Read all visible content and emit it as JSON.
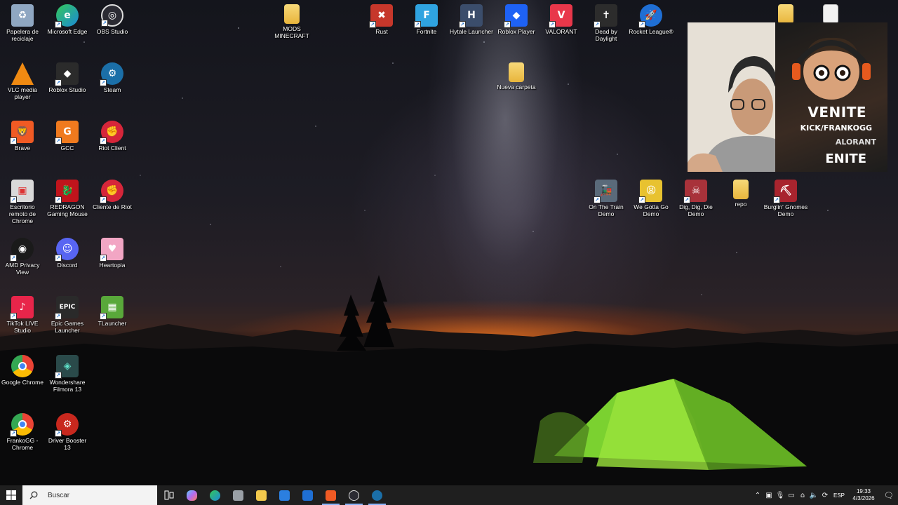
{
  "desktop": {
    "icons": [
      {
        "key": "recycle",
        "label": "Papelera de reciclaje",
        "icon": "recycle-bin-icon",
        "color": "#8fa7c2"
      },
      {
        "key": "edge",
        "label": "Microsoft Edge",
        "icon": "edge-icon",
        "color": "#1b8ad8"
      },
      {
        "key": "obs",
        "label": "OBS Studio",
        "icon": "obs-icon",
        "color": "#2b2b33"
      },
      {
        "key": "mods",
        "label": "MODS MINECRAFT",
        "icon": "folder-icon",
        "color": "#f2c94c"
      },
      {
        "key": "rust",
        "label": "Rust",
        "icon": "rust-icon",
        "color": "#c6372b"
      },
      {
        "key": "fortnite",
        "label": "Fortnite",
        "icon": "fortnite-icon",
        "color": "#2fa3e0"
      },
      {
        "key": "hytale",
        "label": "Hytale Launcher",
        "icon": "hytale-icon",
        "color": "#3b4d6b"
      },
      {
        "key": "roblox_player",
        "label": "Roblox Player",
        "icon": "roblox-player-icon",
        "color": "#1e62f5"
      },
      {
        "key": "valorant",
        "label": "VALORANT",
        "icon": "valorant-icon",
        "color": "#e8374a"
      },
      {
        "key": "dbd",
        "label": "Dead by Daylight",
        "icon": "dead-by-daylight-icon",
        "color": "#2c2c2c"
      },
      {
        "key": "rocket",
        "label": "Rocket League®",
        "icon": "rocket-league-icon",
        "color": "#1f6fd4"
      },
      {
        "key": "vlc",
        "label": "VLC media player",
        "icon": "vlc-icon",
        "color": "#f08a12"
      },
      {
        "key": "roblox_studio",
        "label": "Roblox Studio",
        "icon": "roblox-studio-icon",
        "color": "#2b2b2b"
      },
      {
        "key": "steam",
        "label": "Steam",
        "icon": "steam-icon",
        "color": "#1b6fa8"
      },
      {
        "key": "nueva",
        "label": "Nueva carpeta",
        "icon": "folder-icon",
        "color": "#f2c94c"
      },
      {
        "key": "brave",
        "label": "Brave",
        "icon": "brave-icon",
        "color": "#f05a24"
      },
      {
        "key": "gcc",
        "label": "GCC",
        "icon": "gcc-icon",
        "color": "#f07a1e"
      },
      {
        "key": "riot",
        "label": "Riot Client",
        "icon": "riot-client-icon",
        "color": "#d6263a"
      },
      {
        "key": "chrome_remote",
        "label": "Escritorio remoto de Chrome",
        "icon": "chrome-remote-desktop-icon",
        "color": "#d9d9d9"
      },
      {
        "key": "redragon",
        "label": "REDRAGON Gaming Mouse",
        "icon": "redragon-icon",
        "color": "#c0141c"
      },
      {
        "key": "cliente_riot",
        "label": "Cliente de Riot",
        "icon": "riot-client-icon",
        "color": "#d6263a"
      },
      {
        "key": "amd",
        "label": "AMD Privacy View",
        "icon": "amd-privacy-icon",
        "color": "#1a1a1a"
      },
      {
        "key": "discord",
        "label": "Discord",
        "icon": "discord-icon",
        "color": "#5865f2"
      },
      {
        "key": "heartopia",
        "label": "Heartopia",
        "icon": "heartopia-icon",
        "color": "#f2a6c4"
      },
      {
        "key": "tiktok",
        "label": "TikTok LIVE Studio",
        "icon": "tiktok-icon",
        "color": "#e8254a"
      },
      {
        "key": "epic",
        "label": "Epic Games Launcher",
        "icon": "epic-games-icon",
        "color": "#2a2a2a"
      },
      {
        "key": "tlauncher",
        "label": "TLauncher",
        "icon": "tlauncher-icon",
        "color": "#59a83a"
      },
      {
        "key": "chrome",
        "label": "Google Chrome",
        "icon": "chrome-icon",
        "color": "#ea4335"
      },
      {
        "key": "filmora",
        "label": "Wondershare Filmora 13",
        "icon": "filmora-icon",
        "color": "#2a4a4a"
      },
      {
        "key": "frankogg",
        "label": "FrankoGG - Chrome",
        "icon": "chrome-profile-icon",
        "color": "#ea4335"
      },
      {
        "key": "driver_booster",
        "label": "Driver Booster 13",
        "icon": "driver-booster-icon",
        "color": "#c8281e"
      },
      {
        "key": "on_train",
        "label": "On The Train Demo",
        "icon": "on-the-train-icon",
        "color": "#5a6a7a"
      },
      {
        "key": "we_gotta",
        "label": "We Gotta Go Demo",
        "icon": "we-gotta-go-icon",
        "color": "#e8c230"
      },
      {
        "key": "dig",
        "label": "Dig, Dig, Die Demo",
        "icon": "dig-dig-die-icon",
        "color": "#a8323a"
      },
      {
        "key": "repo",
        "label": "repo",
        "icon": "folder-icon",
        "color": "#f2c94c"
      },
      {
        "key": "burglin",
        "label": "Burglin' Gnomes Demo",
        "icon": "burglin-gnomes-icon",
        "color": "#a8242e"
      }
    ]
  },
  "webcam": {
    "poster_line1": "VENITE",
    "poster_line2": "KICK/FRANKOGG",
    "poster_line3": "ALORANT",
    "poster_line4": "ENITE"
  },
  "taskbar": {
    "search_placeholder": "Buscar",
    "apps": [
      {
        "name": "task-view-icon",
        "color": "#3a3a3a"
      },
      {
        "name": "copilot-icon",
        "color": "#b46cf0"
      },
      {
        "name": "edge-icon",
        "color": "#1b8ad8"
      },
      {
        "name": "file-explorer-icon",
        "color": "#9aa0a6"
      },
      {
        "name": "folder-icon",
        "color": "#f2c94c"
      },
      {
        "name": "microsoft-store-icon",
        "color": "#2b7fe0"
      },
      {
        "name": "mail-icon",
        "color": "#1f6fd4"
      },
      {
        "name": "brave-icon",
        "color": "#f05a24"
      },
      {
        "name": "obs-icon",
        "color": "#2b2b33"
      },
      {
        "name": "steam-icon",
        "color": "#1b6fa8"
      }
    ],
    "tray": {
      "language": "ESP",
      "time": "19:33",
      "date": "4/3/2026"
    }
  }
}
